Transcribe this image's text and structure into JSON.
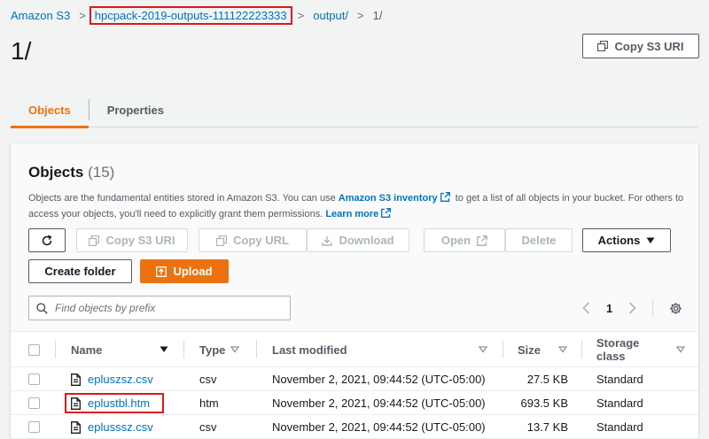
{
  "breadcrumb": {
    "root": "Amazon S3",
    "bucket": "hpcpack-2019-outputs-111122223333",
    "folder": "output/",
    "current": "1/",
    "separator": ">"
  },
  "page": {
    "title": "1/",
    "copy_uri_label": "Copy S3 URI"
  },
  "tabs": [
    {
      "label": "Objects",
      "active": true
    },
    {
      "label": "Properties",
      "active": false
    }
  ],
  "objects_panel": {
    "title": "Objects",
    "count": "(15)",
    "desc_part1": "Objects are the fundamental entities stored in Amazon S3. You can use",
    "desc_link1": "Amazon S3 inventory",
    "desc_part2": "to get a list of all objects in your bucket. For others to access your objects, you'll need to explicitly grant them permissions.",
    "desc_link2": "Learn more"
  },
  "toolbar": {
    "copy_uri": "Copy S3 URI",
    "copy_url": "Copy URL",
    "download": "Download",
    "open": "Open",
    "delete": "Delete",
    "actions": "Actions",
    "create_folder": "Create folder",
    "upload": "Upload"
  },
  "search": {
    "placeholder": "Find objects by prefix"
  },
  "pagination": {
    "current_page": "1"
  },
  "table": {
    "columns": {
      "name": "Name",
      "type": "Type",
      "last_modified": "Last modified",
      "size": "Size",
      "storage_class": "Storage class"
    },
    "rows": [
      {
        "name": "epluszsz.csv",
        "type": "csv",
        "last_modified": "November 2, 2021, 09:44:52 (UTC-05:00)",
        "size": "27.5 KB",
        "storage_class": "Standard"
      },
      {
        "name": "eplustbl.htm",
        "type": "htm",
        "last_modified": "November 2, 2021, 09:44:52 (UTC-05:00)",
        "size": "693.5 KB",
        "storage_class": "Standard"
      },
      {
        "name": "eplusssz.csv",
        "type": "csv",
        "last_modified": "November 2, 2021, 09:44:52 (UTC-05:00)",
        "size": "13.7 KB",
        "storage_class": "Standard"
      }
    ]
  },
  "colors": {
    "link": "#0073bb",
    "accent_orange": "#ec7211",
    "highlight_red": "#e0161a",
    "text_secondary": "#545b64"
  },
  "icons": {
    "copy": "copy-icon",
    "refresh": "refresh-icon",
    "download": "download-icon",
    "external": "external-link-icon",
    "upload": "upload-icon",
    "search": "search-icon",
    "settings": "gear-icon",
    "file": "file-icon"
  }
}
